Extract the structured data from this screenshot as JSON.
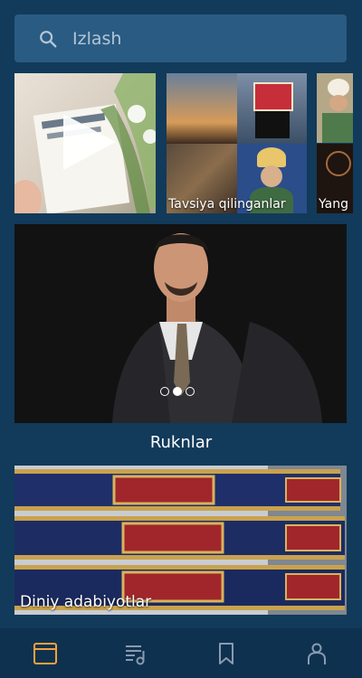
{
  "search": {
    "placeholder": "Izlash"
  },
  "tiles": [
    {
      "name": "video",
      "caption": ""
    },
    {
      "name": "recommended",
      "caption": "Tavsiya qilinganlar"
    },
    {
      "name": "partial",
      "caption": "Yang"
    }
  ],
  "banner": {
    "dots": 3,
    "active_dot": 2
  },
  "section": {
    "title": "Ruknlar"
  },
  "category": {
    "caption": "Diniy adabiyotlar"
  },
  "nav": {
    "items": [
      {
        "name": "home",
        "icon": "browser-window-icon",
        "active": true
      },
      {
        "name": "music",
        "icon": "music-list-icon",
        "active": false
      },
      {
        "name": "bookmarks",
        "icon": "bookmark-icon",
        "active": false
      },
      {
        "name": "profile",
        "icon": "person-icon",
        "active": false
      }
    ]
  },
  "colors": {
    "accent": "#f2a23a",
    "background": "#123a5a",
    "search_bg": "#2a5b82"
  }
}
